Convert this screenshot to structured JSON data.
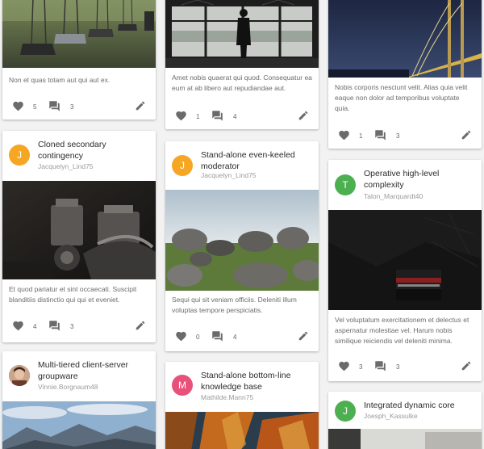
{
  "colors": {
    "avatar_orange": "#f5a623",
    "avatar_green": "#4caf50",
    "avatar_pink": "#e8517a",
    "icon_gray": "#6b6b6b"
  },
  "columns": [
    {
      "cards": [
        {
          "description": "Non et quas totam aut qui aut ex.",
          "likes": "5",
          "comments": "3"
        },
        {
          "avatar_letter": "J",
          "title": "Cloned secondary contingency",
          "username": "Jacquelyn_Lind75",
          "description": "Et quod pariatur et sint occaecati. Suscipit blanditiis distinctio qui qui et eveniet.",
          "likes": "4",
          "comments": "3"
        },
        {
          "title": "Multi-tiered client-server groupware",
          "username": "Vinnie.Borgnaum48"
        }
      ]
    },
    {
      "cards": [
        {
          "description": "Amet nobis quaerat qui quod. Consequatur ea eum at ab libero aut repudiandae aut.",
          "likes": "1",
          "comments": "4"
        },
        {
          "avatar_letter": "J",
          "title": "Stand-alone even-keeled moderator",
          "username": "Jacquelyn_Lind75",
          "description": "Sequi qui sit veniam officiis. Deleniti illum voluptas tempore perspiciatis.",
          "likes": "0",
          "comments": "4"
        },
        {
          "avatar_letter": "M",
          "title": "Stand-alone bottom-line knowledge base",
          "username": "Mathilde.Mann75"
        }
      ]
    },
    {
      "cards": [
        {
          "description": "Nobis corporis nesciunt velit. Alias quia velit eaque non dolor ad temporibus voluptate quia.",
          "likes": "1",
          "comments": "3"
        },
        {
          "avatar_letter": "T",
          "title": "Operative high-level complexity",
          "username": "Talon_Marquardt40",
          "description": "Vel voluptatum exercitationem et delectus et aspernatur molestiae vel. Harum nobis similique reiciendis vel deleniti minima.",
          "likes": "3",
          "comments": "3"
        },
        {
          "avatar_letter": "J",
          "title": "Integrated dynamic core",
          "username": "Joesph_Kassulke"
        }
      ]
    }
  ]
}
